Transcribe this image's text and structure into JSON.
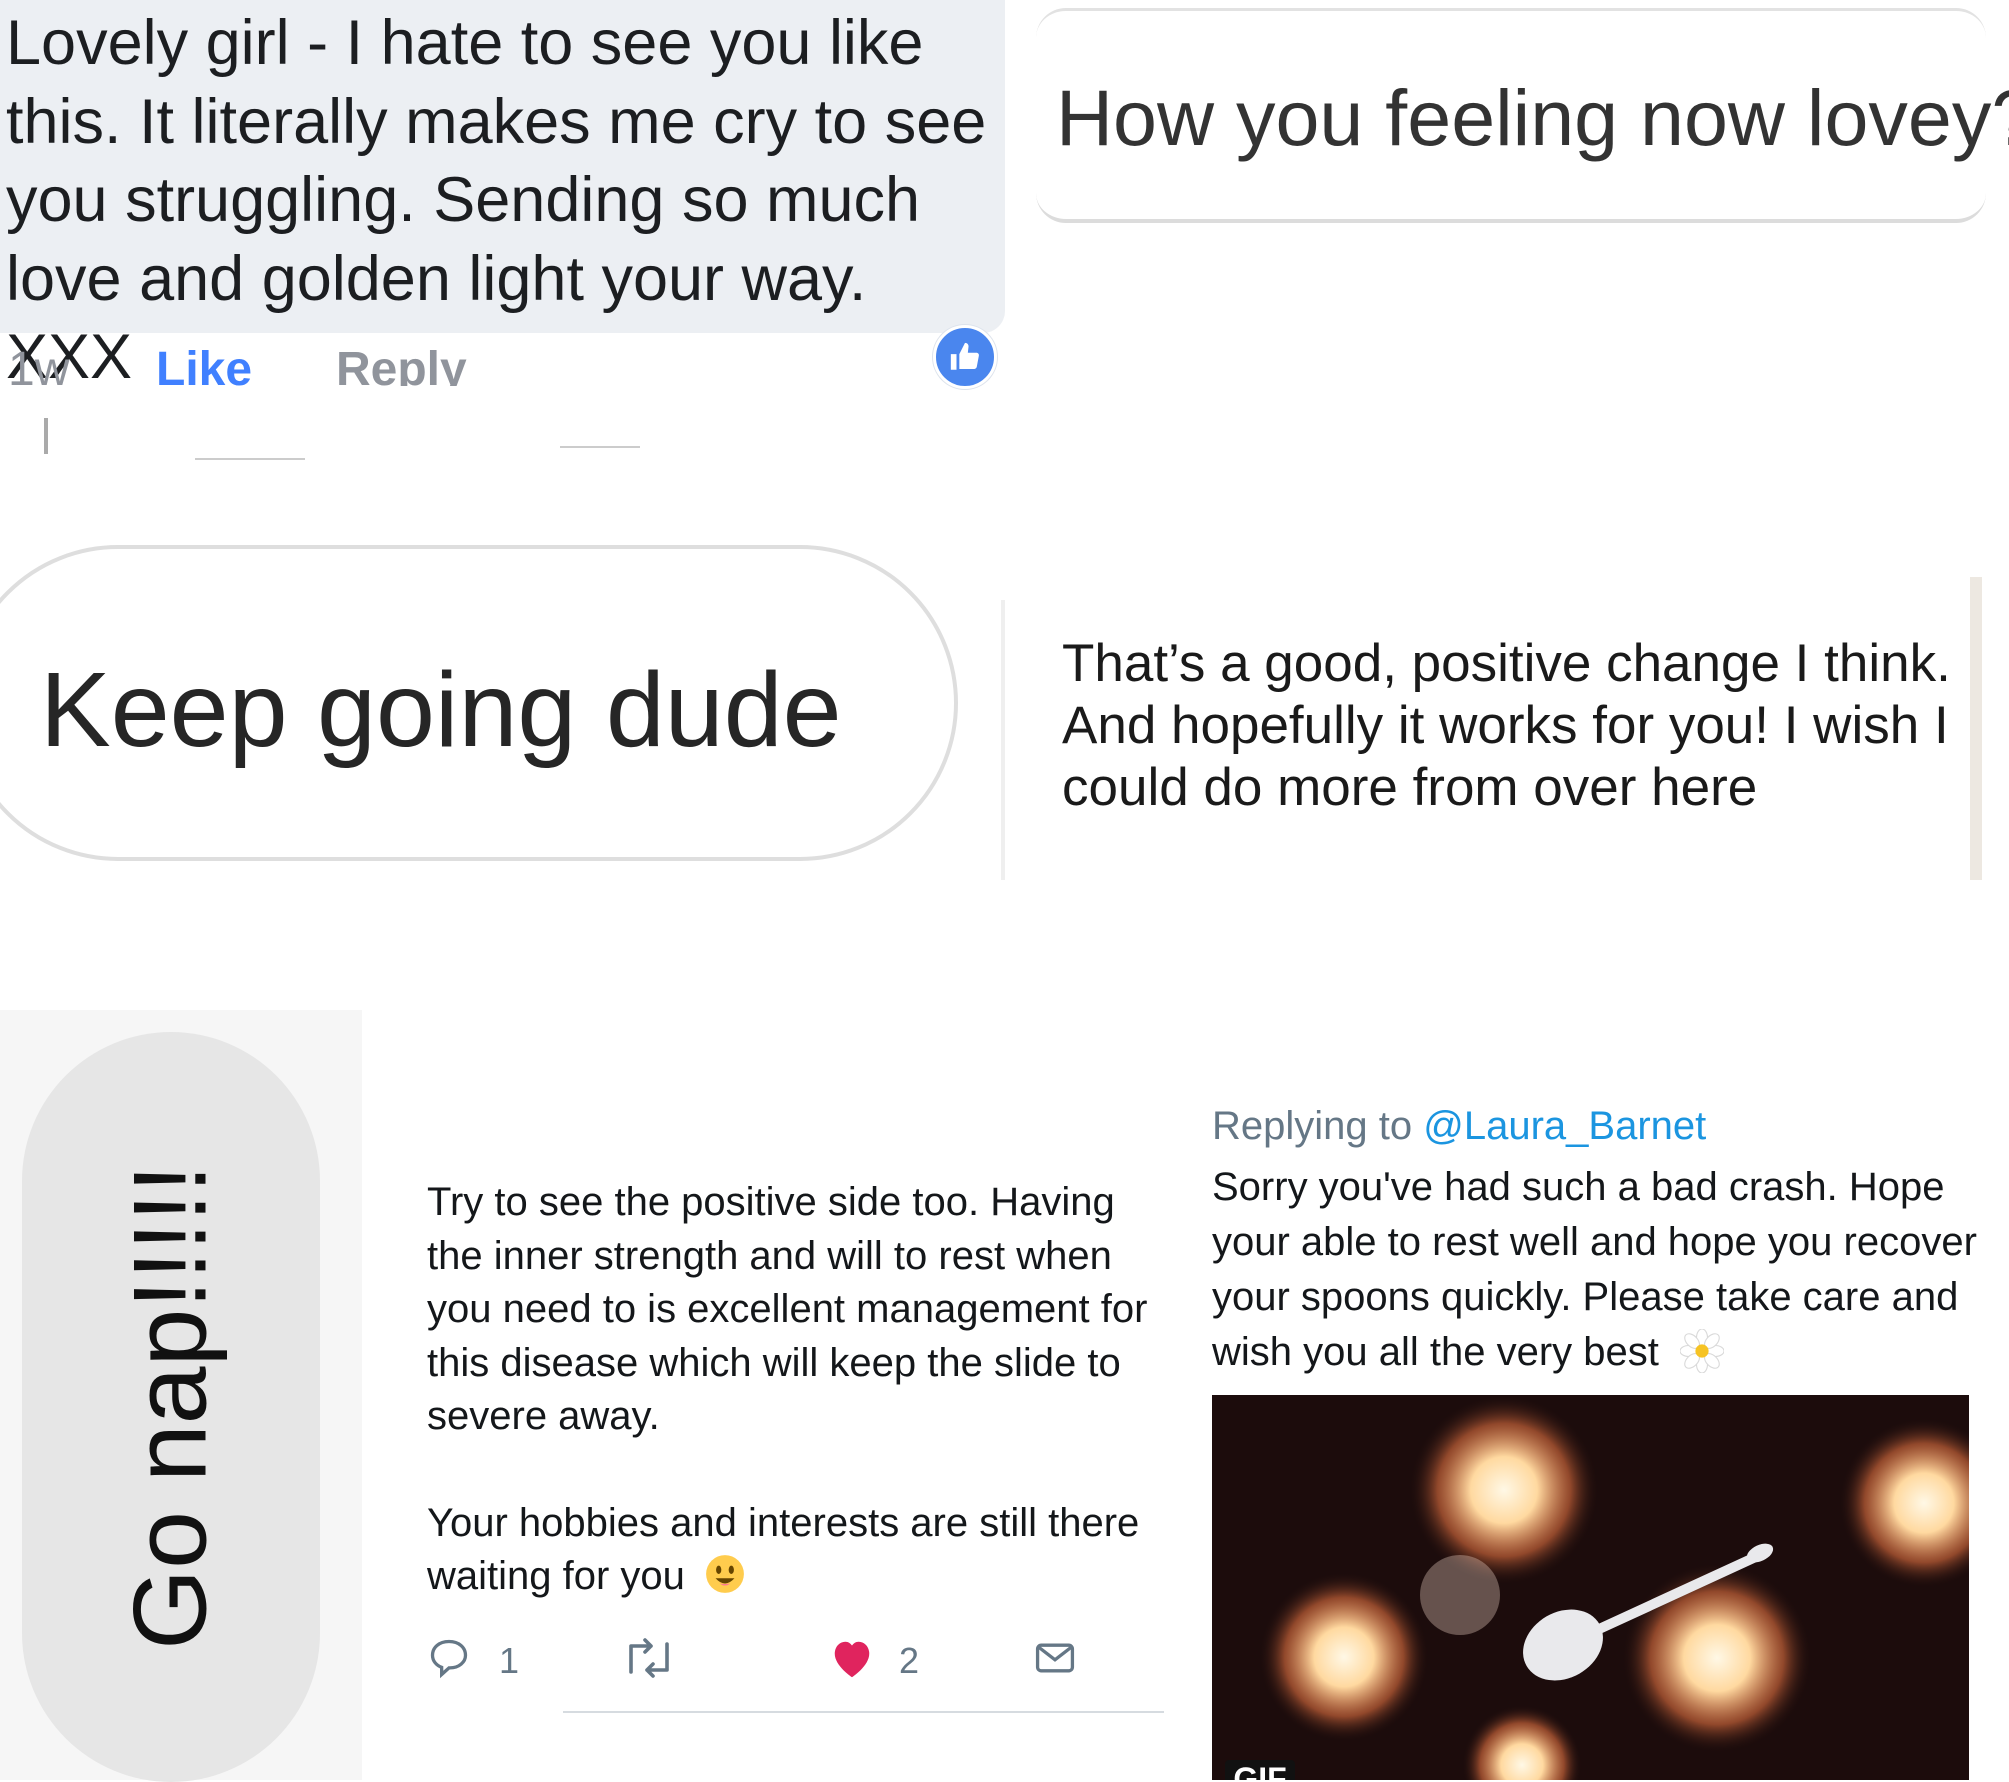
{
  "fb_comment": {
    "text": "Lovely girl - I hate to see you like this. It literally makes me cry to see you struggling. Sending so much love and golden light your way. XXX",
    "time": "1w",
    "like_label": "Like",
    "reply_label": "Reply",
    "colors": {
      "bubble": "#eceff3",
      "like": "#4080ff",
      "badge": "#4a86ee"
    }
  },
  "message_lovey": {
    "text": "How you feeling now lovey?"
  },
  "message_dude": {
    "text": "Keep going dude"
  },
  "message_good": {
    "text": "That’s a good, positive change I think. And hopefully it works for you! I wish I could do more from over here"
  },
  "message_nap": {
    "text": "Go nap!!!!!"
  },
  "tweet_positive": {
    "paragraph1": "Try to see the positive side too. Having the inner strength and will to rest when you need to is excellent management for this disease which will keep the slide to severe away.",
    "paragraph2": "Your hobbies and interests are still there waiting for you",
    "reply_count": "1",
    "like_count": "2",
    "colors": {
      "heart": "#e0245e",
      "icon": "#657786"
    }
  },
  "tweet_reply": {
    "replying_prefix": "Replying to",
    "handle": "@Laura_Barnet",
    "text": "Sorry you've had such a bad crash. Hope your able to rest well and hope you recover your spoons quickly. Please take care and wish you all the very best",
    "gif_label": "GIF",
    "colors": {
      "handle": "#1b95e0",
      "muted": "#657786"
    }
  }
}
